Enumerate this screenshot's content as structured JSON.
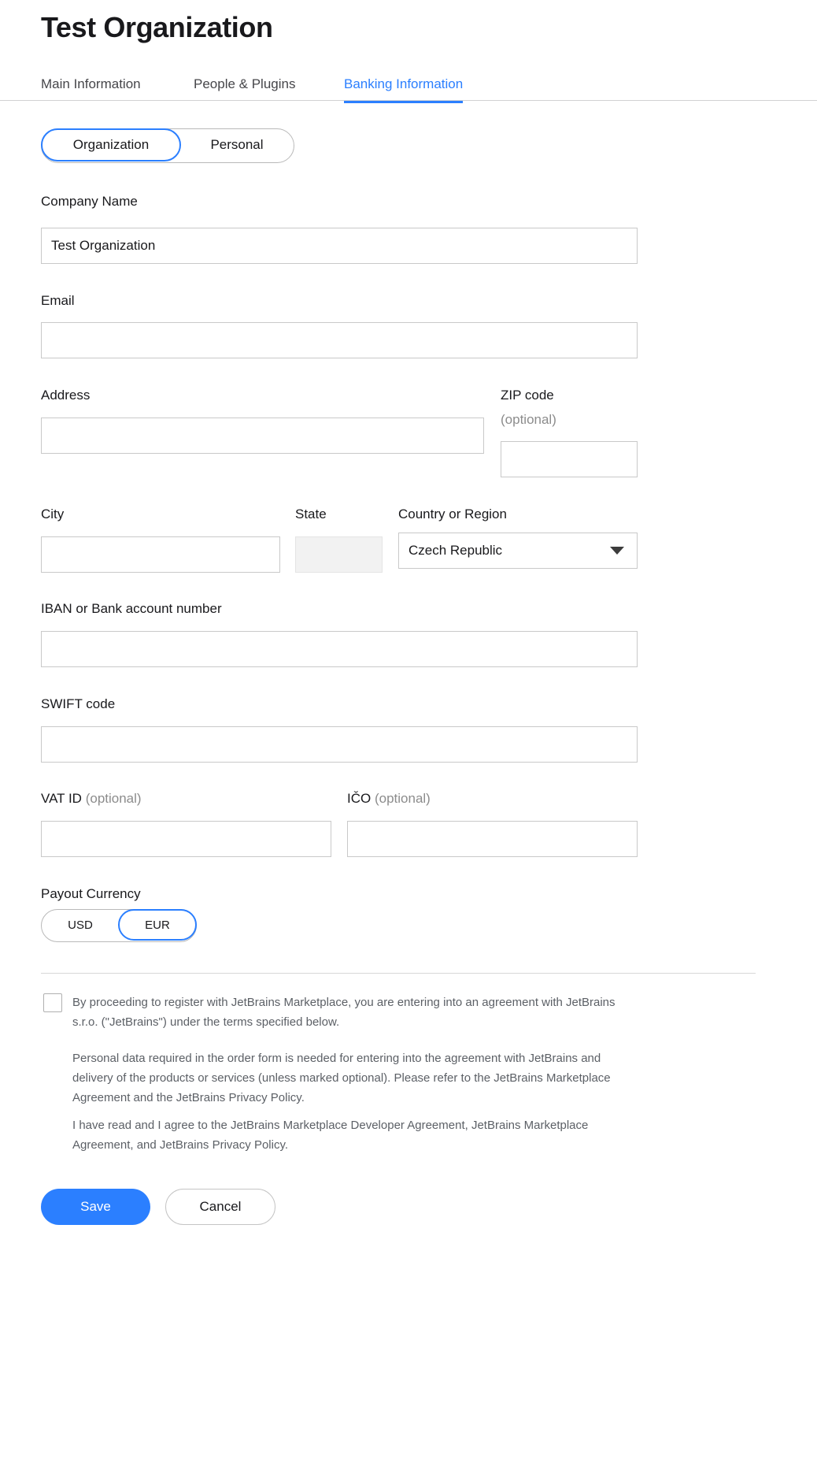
{
  "header": {
    "title": "Test Organization",
    "tabs": [
      {
        "label": "Main Information",
        "active": false
      },
      {
        "label": "People & Plugins",
        "active": false
      },
      {
        "label": "Banking Information",
        "active": true
      }
    ]
  },
  "entity_toggle": {
    "options": [
      "Organization",
      "Personal"
    ],
    "selected": "Organization"
  },
  "form": {
    "company_name": {
      "label": "Company Name",
      "value": "Test Organization",
      "placeholder": ""
    },
    "email": {
      "label": "Email",
      "value": "",
      "placeholder": ""
    },
    "address": {
      "label": "Address",
      "value": "",
      "placeholder": ""
    },
    "zip_code": {
      "label": "ZIP code",
      "sub_label": "(optional)",
      "value": "",
      "placeholder": ""
    },
    "city": {
      "label": "City",
      "value": "",
      "placeholder": ""
    },
    "state": {
      "label": "State",
      "value": "",
      "placeholder": "",
      "disabled": true
    },
    "country": {
      "label": "Country or Region",
      "value": "Czech Republic",
      "icon": "chevron-down-icon"
    },
    "iban": {
      "label": "IBAN or Bank account number",
      "value": "",
      "placeholder": ""
    },
    "swift": {
      "label": "SWIFT code",
      "value": "",
      "placeholder": ""
    },
    "vat_id": {
      "label": "VAT ID",
      "optional": "(optional)",
      "value": "",
      "placeholder": ""
    },
    "ico": {
      "label": "IČO",
      "optional": "(optional)",
      "value": "",
      "placeholder": ""
    }
  },
  "payout_currency": {
    "label": "Payout Currency",
    "options": [
      "USD",
      "EUR"
    ],
    "selected": "EUR"
  },
  "legal": {
    "checkbox_checked": false,
    "paragraphs": [
      "By proceeding to register with JetBrains Marketplace, you are entering into an agreement with JetBrains s.r.o. (\"JetBrains\") under the terms specified below.",
      "Personal data required in the order form is needed for entering into the agreement with JetBrains and delivery of the products or services (unless marked optional). Please refer to the JetBrains Marketplace Agreement and the JetBrains Privacy Policy.",
      "I have read and I agree to the JetBrains Marketplace Developer Agreement, JetBrains Marketplace Agreement, and JetBrains Privacy Policy."
    ]
  },
  "actions": {
    "save_label": "Save",
    "cancel_label": "Cancel"
  },
  "colors": {
    "accent": "#2b7fff",
    "text": "#19191c",
    "muted": "#8c8c8c",
    "legal_text": "#5c6066",
    "border": "#c9c9c9"
  }
}
